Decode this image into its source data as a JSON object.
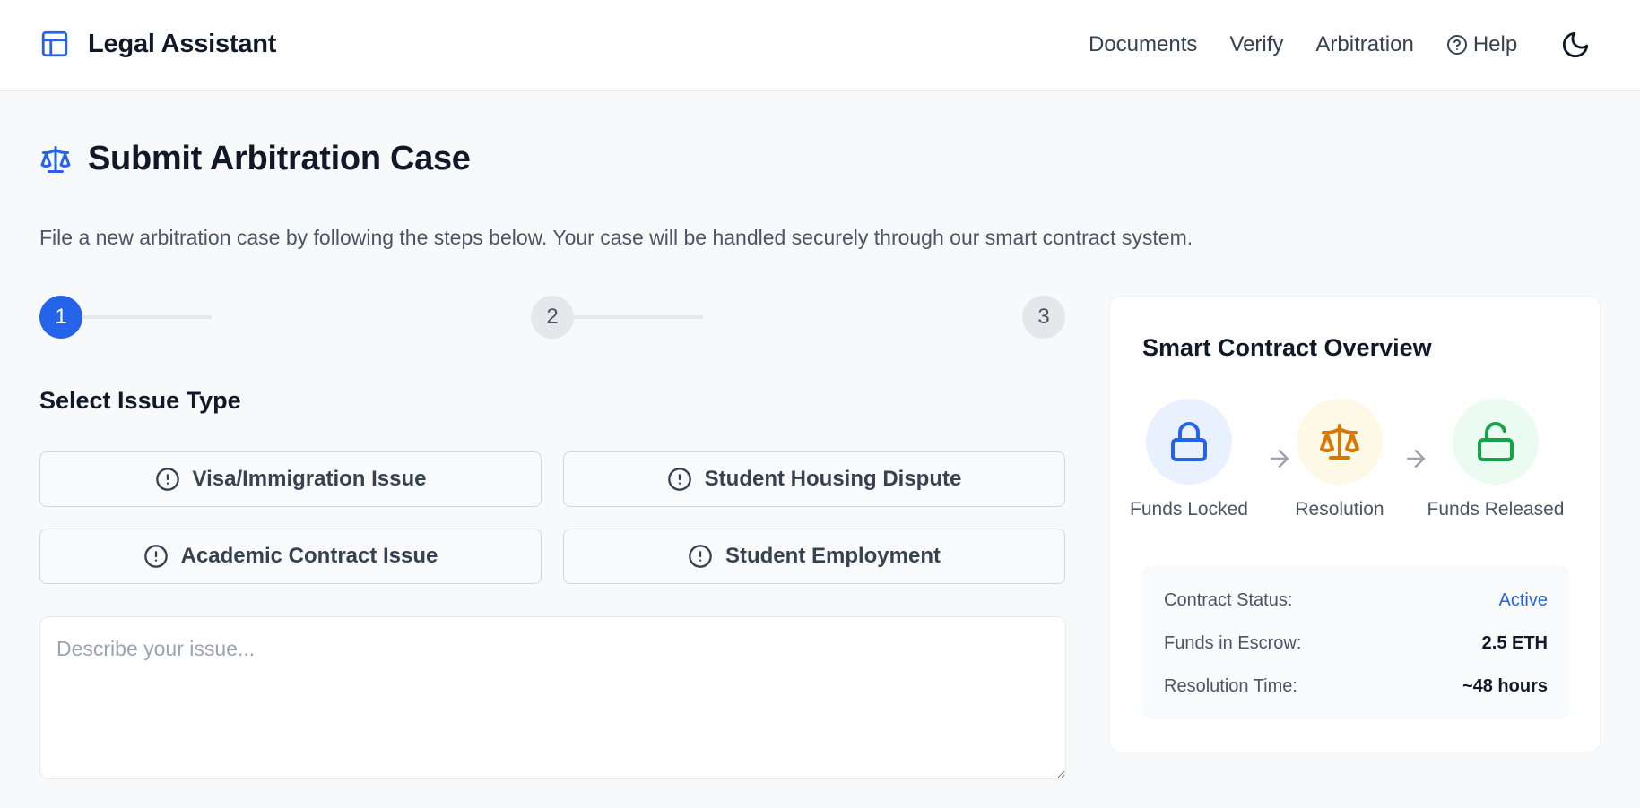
{
  "header": {
    "title": "Legal Assistant",
    "nav": [
      "Documents",
      "Verify",
      "Arbitration"
    ],
    "help_label": "Help"
  },
  "page": {
    "title": "Submit Arbitration Case",
    "description": "File a new arbitration case by following the steps below. Your case will be handled securely through our smart contract system."
  },
  "steps": [
    "1",
    "2",
    "3"
  ],
  "issue_section": {
    "title": "Select Issue Type",
    "options": [
      "Visa/Immigration Issue",
      "Student Housing Dispute",
      "Academic Contract Issue",
      "Student Employment"
    ]
  },
  "description_input": {
    "value": "",
    "placeholder": "Describe your issue..."
  },
  "contract_panel": {
    "title": "Smart Contract Overview",
    "flow": [
      {
        "label": "Funds Locked",
        "icon": "lock-icon",
        "color": "#2563eb",
        "bg": "#eaf1fe"
      },
      {
        "label": "Resolution",
        "icon": "scale-icon",
        "color": "#d97706",
        "bg": "#fef8e7"
      },
      {
        "label": "Funds Released",
        "icon": "unlock-icon",
        "color": "#16a34a",
        "bg": "#ecfbf1"
      }
    ],
    "status": [
      {
        "key": "Contract Status:",
        "value": "Active"
      },
      {
        "key": "Funds in Escrow:",
        "value": "2.5 ETH"
      },
      {
        "key": "Resolution Time:",
        "value": "~48 hours"
      }
    ]
  },
  "colors": {
    "accent": "#2563eb",
    "background": "#f8f9fb"
  }
}
